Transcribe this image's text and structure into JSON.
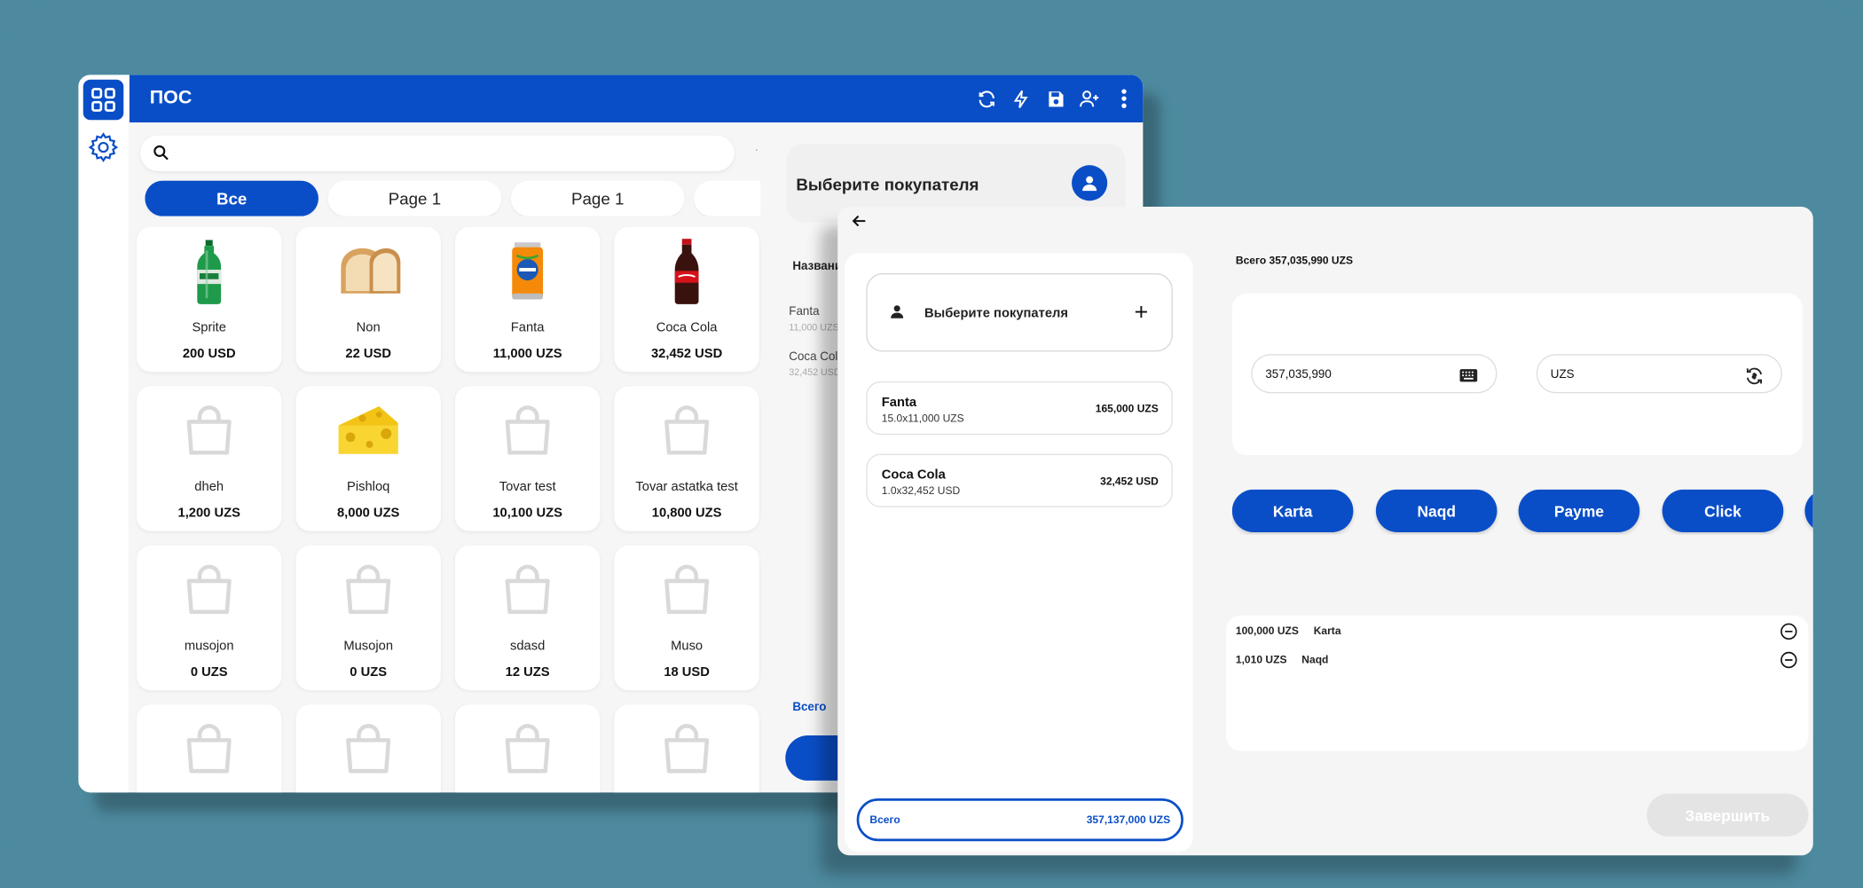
{
  "app": {
    "title": "ПОС",
    "search": {
      "placeholder": "",
      "value": ""
    },
    "tabs": [
      {
        "label": "Все",
        "active": true
      },
      {
        "label": "Page 1",
        "active": false
      },
      {
        "label": "Page 1",
        "active": false
      },
      {
        "label": "",
        "active": false
      }
    ],
    "products": [
      {
        "name": "Sprite",
        "price": "200 USD",
        "icon": "sprite-bottle"
      },
      {
        "name": "Non",
        "price": "22 USD",
        "icon": "bread"
      },
      {
        "name": "Fanta",
        "price": "11,000 UZS",
        "icon": "fanta-can"
      },
      {
        "name": "Coca Cola",
        "price": "32,452 USD",
        "icon": "cola-bottle"
      },
      {
        "name": "dheh",
        "price": "1,200 UZS",
        "icon": "bag-placeholder"
      },
      {
        "name": "Pishloq",
        "price": "8,000 UZS",
        "icon": "cheese"
      },
      {
        "name": "Tovar test",
        "price": "10,100 UZS",
        "icon": "bag-placeholder"
      },
      {
        "name": "Tovar astatka test",
        "price": "10,800 UZS",
        "icon": "bag-placeholder"
      },
      {
        "name": "musojon",
        "price": "0 UZS",
        "icon": "bag-placeholder"
      },
      {
        "name": "Musojon",
        "price": "0 UZS",
        "icon": "bag-placeholder"
      },
      {
        "name": "sdasd",
        "price": "12 UZS",
        "icon": "bag-placeholder"
      },
      {
        "name": "Muso",
        "price": "18 USD",
        "icon": "bag-placeholder"
      },
      {
        "name": "",
        "price": "",
        "icon": "bag-placeholder"
      },
      {
        "name": "",
        "price": "",
        "icon": "bag-placeholder"
      },
      {
        "name": "",
        "price": "",
        "icon": "bag-placeholder"
      },
      {
        "name": "",
        "price": "",
        "icon": "bag-placeholder"
      }
    ],
    "back_panel": {
      "customer_label": "Выберите покупателя",
      "column_header": "Названи",
      "items": [
        {
          "name": "Fanta",
          "sub": "11,000 UZS"
        },
        {
          "name": "Coca Cola",
          "sub": "32,452 USD"
        }
      ],
      "total_label": "Всего"
    }
  },
  "checkout": {
    "customer_label": "Выберите покупателя",
    "cart": [
      {
        "name": "Fanta",
        "qty": "15.0x11,000 UZS",
        "total": "165,000 UZS"
      },
      {
        "name": "Coca Cola",
        "qty": "1.0x32,452 USD",
        "total": "32,452 USD"
      }
    ],
    "total": {
      "label": "Всего",
      "value": "357,137,000 UZS"
    },
    "summary": "Всего 357,035,990 UZS",
    "amount": "357,035,990",
    "currency": "UZS",
    "methods": [
      "Karta",
      "Naqd",
      "Payme",
      "Click",
      ""
    ],
    "payments": [
      {
        "amount": "100,000",
        "currency": "UZS",
        "method": "Karta"
      },
      {
        "amount": "1,010",
        "currency": "UZS",
        "method": "Naqd"
      }
    ],
    "finish_label": "Завершить"
  },
  "colors": {
    "accent": "#0a4ec7",
    "background": "#4d8a9f",
    "panel": "#f5f5f5",
    "disabled": "#e4e4e4"
  }
}
